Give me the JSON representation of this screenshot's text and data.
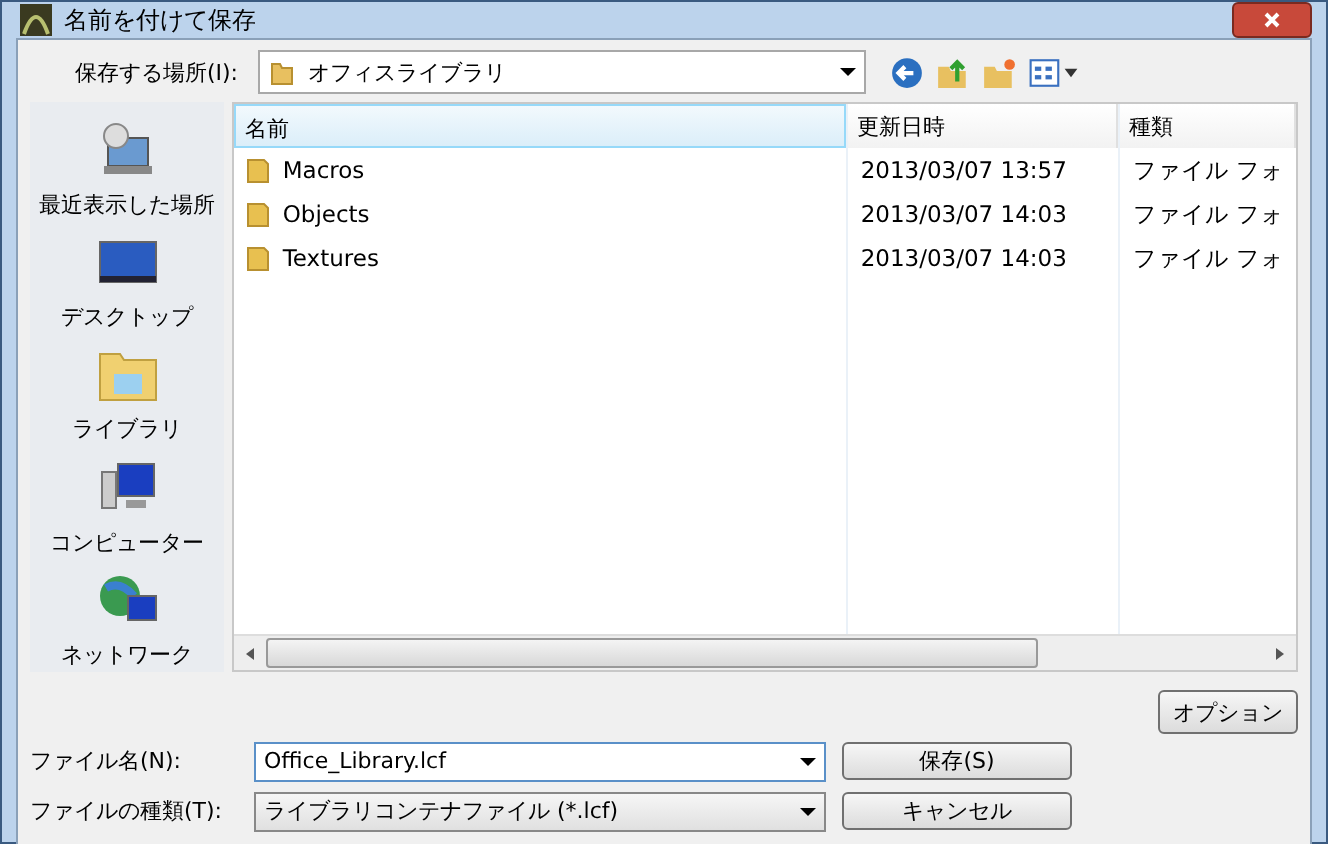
{
  "window": {
    "title": "名前を付けて保存"
  },
  "location": {
    "label": "保存する場所(I):",
    "value": "オフィスライブラリ"
  },
  "places": [
    {
      "label": "最近表示した場所",
      "kind": "recent"
    },
    {
      "label": "デスクトップ",
      "kind": "desktop"
    },
    {
      "label": "ライブラリ",
      "kind": "library"
    },
    {
      "label": "コンピューター",
      "kind": "computer"
    },
    {
      "label": "ネットワーク",
      "kind": "network"
    }
  ],
  "table": {
    "columns": [
      "名前",
      "更新日時",
      "種類"
    ],
    "rows": [
      {
        "name": "Macros",
        "date": "2013/03/07 13:57",
        "type": "ファイル フォ"
      },
      {
        "name": "Objects",
        "date": "2013/03/07 14:03",
        "type": "ファイル フォ"
      },
      {
        "name": "Textures",
        "date": "2013/03/07 14:03",
        "type": "ファイル フォ"
      }
    ]
  },
  "options_button": "オプション",
  "filename": {
    "label": "ファイル名(N):",
    "value": "Office_Library.lcf"
  },
  "filetype": {
    "label": "ファイルの種類(T):",
    "value": "ライブラリコンテナファイル (*.lcf)"
  },
  "buttons": [
    "保存(S)",
    "キャンセル"
  ]
}
